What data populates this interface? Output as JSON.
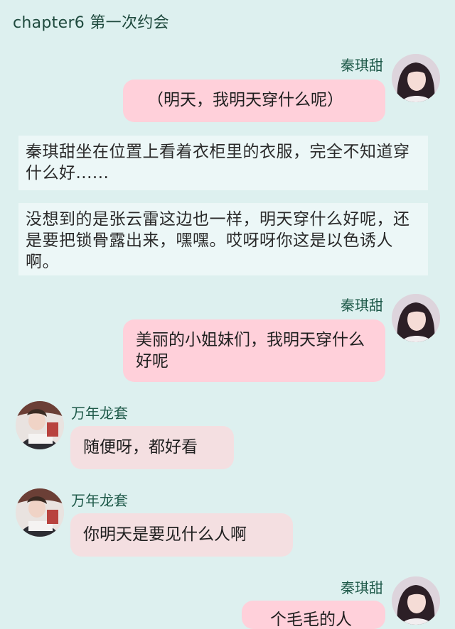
{
  "chapter_title": "chapter6 第一次约会",
  "messages": [
    {
      "speaker": "秦琪甜",
      "text": "（明天，我明天穿什么呢）"
    },
    {
      "narration": "秦琪甜坐在位置上看着衣柜里的衣服，完全不知道穿什么好......"
    },
    {
      "narration": "没想到的是张云雷这边也一样，明天穿什么好呢，还是要把锁骨露出来，嘿嘿。哎呀呀你这是以色诱人啊。"
    },
    {
      "speaker": "秦琪甜",
      "text": "美丽的小姐妹们，我明天穿什么好呢"
    },
    {
      "speaker": "万年龙套",
      "text": "随便呀，都好看"
    },
    {
      "speaker": "万年龙套",
      "text": "你明天是要见什么人啊"
    },
    {
      "speaker": "秦琪甜",
      "text": "个毛毛的人"
    }
  ],
  "colors": {
    "background": "#ddf0ef",
    "right_bubble": "#ffd0da",
    "left_bubble": "#f4dfe1",
    "narration_box": "#ecf7f7",
    "name_text": "#1f5a4a"
  }
}
